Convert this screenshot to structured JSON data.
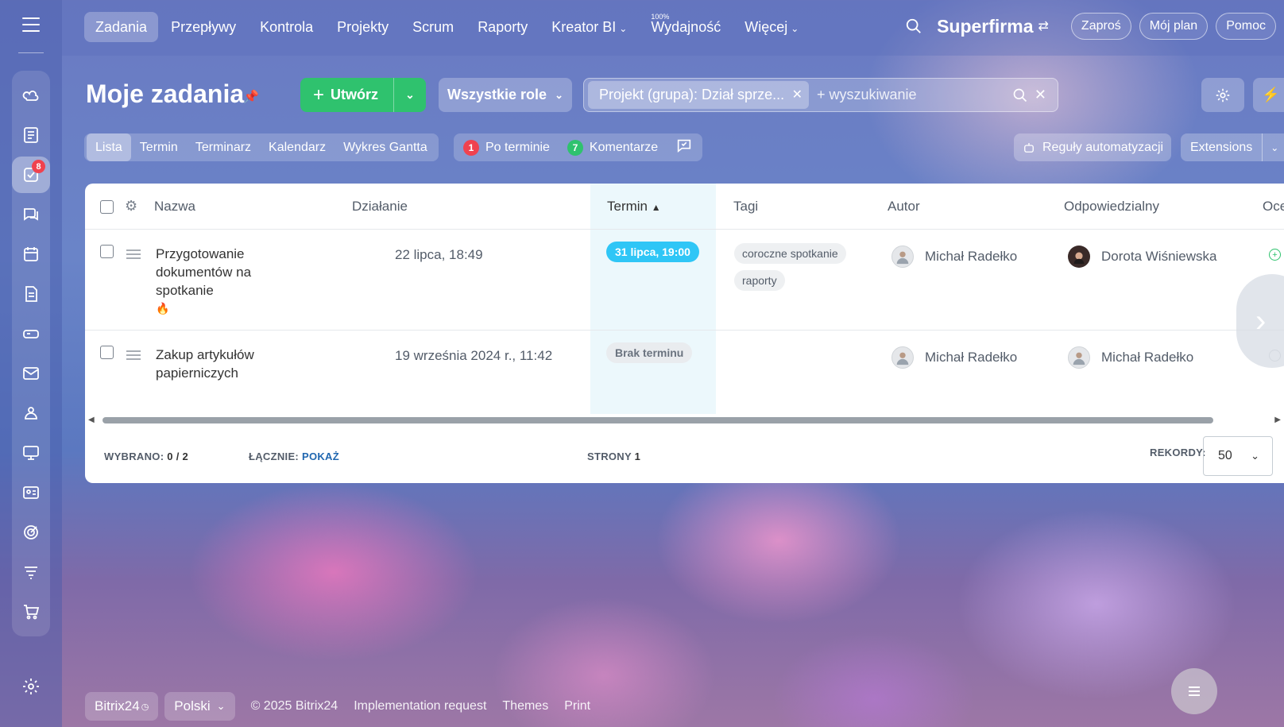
{
  "topnav": {
    "tabs": [
      {
        "label": "Zadania"
      },
      {
        "label": "Przepływy"
      },
      {
        "label": "Kontrola"
      },
      {
        "label": "Projekty"
      },
      {
        "label": "Scrum"
      },
      {
        "label": "Raporty"
      },
      {
        "label": "Kreator BI"
      },
      {
        "label": "Wydajność",
        "sup": "100%"
      },
      {
        "label": "Więcej"
      }
    ],
    "brand": "Superfirma",
    "buttons": {
      "invite": "Zaproś",
      "plan": "Mój plan",
      "help": "Pomoc"
    }
  },
  "sidebar": {
    "tasks_badge": "8",
    "icons": [
      "feed-icon",
      "news-icon",
      "tasks-icon",
      "chat-icon",
      "calendar-icon",
      "docs-icon",
      "drive-icon",
      "mail-icon",
      "groups-icon",
      "sites-icon",
      "crm-icon",
      "goals-icon",
      "filter-icon",
      "cart-icon",
      "settings-icon"
    ]
  },
  "header": {
    "title": "Moje zadania",
    "create_label": "Utwórz",
    "roles_label": "Wszystkie role",
    "filter_chip": "Projekt (grupa): Dział sprze...",
    "search_placeholder": "+ wyszukiwanie"
  },
  "view_tabs": [
    "Lista",
    "Termin",
    "Terminarz",
    "Kalendarz",
    "Wykres Gantta"
  ],
  "counters": [
    {
      "count": "1",
      "label": "Po terminie",
      "color": "#f0424f"
    },
    {
      "count": "7",
      "label": "Komentarze",
      "color": "#2fc26e"
    }
  ],
  "toolbar_right": {
    "automation": "Reguły automatyzacji",
    "extensions": "Extensions"
  },
  "grid": {
    "columns": {
      "name": "Nazwa",
      "action": "Działanie",
      "deadline": "Termin",
      "tags": "Tagi",
      "author": "Autor",
      "responsible": "Odpowiedzialny",
      "mark": "Oce"
    },
    "rows": [
      {
        "name": "Przygotowanie dokumentów na spotkanie",
        "action": "22 lipca, 18:49",
        "deadline": "31 lipca, 19:00",
        "tags": [
          "coroczne spotkanie",
          "raporty"
        ],
        "author": "Michał Radełko",
        "responsible": "Dorota Wiśniewska"
      },
      {
        "name": "Zakup artykułów papierniczych",
        "action": "19 września 2024 r., 11:42",
        "deadline": "Brak terminu",
        "tags": [],
        "author": "Michał Radełko",
        "responsible": "Michał Radełko"
      }
    ],
    "footer": {
      "selected_label": "WYBRANO:",
      "selected_value": "0 / 2",
      "total_label": "ŁĄCZNIE:",
      "total_link": "POKAŻ",
      "pages_label": "STRONY",
      "pages_value": "1",
      "records_label": "REKORDY:",
      "records_value": "50"
    }
  },
  "footer": {
    "bitrix": "Bitrix24",
    "lang": "Polski",
    "copyright": "© 2025 Bitrix24",
    "impl": "Implementation request",
    "themes": "Themes",
    "print": "Print"
  }
}
